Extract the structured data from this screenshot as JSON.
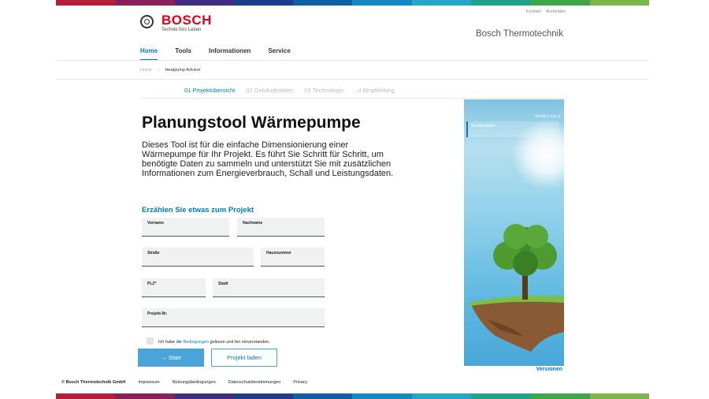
{
  "colors": {
    "accent": "#007bc0",
    "brand_red": "#e20015"
  },
  "top_bar_colors": [
    "#b81c39",
    "#8b1f5a",
    "#3f2d80",
    "#1d3d8c",
    "#0d5fa8",
    "#1388c5",
    "#24a6c8",
    "#1fa38a",
    "#3aa847",
    "#7ab648"
  ],
  "top_links": {
    "contact": "Kontakt",
    "login": "Anmelden"
  },
  "header": {
    "logo_name": "BOSCH",
    "logo_tagline": "Technik fürs Leben",
    "division": "Bosch Thermotechnik"
  },
  "nav": [
    {
      "label": "Home"
    },
    {
      "label": "Tools"
    },
    {
      "label": "Informationen"
    },
    {
      "label": "Service"
    }
  ],
  "breadcrumb": {
    "home": "Home",
    "current": "Heatpump Advisor"
  },
  "steps": [
    {
      "label": "01 Projektübersicht"
    },
    {
      "label": "02 Gebäudedaten"
    },
    {
      "label": "03 Technologie"
    },
    {
      "label": "..ıl Empfehlung"
    }
  ],
  "main": {
    "title": "Planungstool Wärmepumpe",
    "intro": "Dieses Tool ist für die einfache Dimensionierung einer Wärmepumpe für Ihr Projekt. Es führt Sie Schritt für Schritt, um benötigte Daten zu sammeln und unterstützt Sie mit zusätzlichen Informationen zum Energieverbrauch, Schall und Leistungsdaten.",
    "section_title": "Erzählen Sie etwas zum Projekt"
  },
  "form": {
    "vorname": {
      "label": "Vorname",
      "value": ""
    },
    "nachname": {
      "label": "Nachname",
      "value": ""
    },
    "strasse": {
      "label": "Straße",
      "value": ""
    },
    "hausnummer": {
      "label": "Hausnummer",
      "value": ""
    },
    "plz": {
      "label": "PLZ*",
      "value": ""
    },
    "stadt": {
      "label": "Stadt",
      "value": ""
    },
    "projekt_nr": {
      "label": "Projekt-Nr.",
      "value": ""
    }
  },
  "consent": {
    "before": "Ich habe die ",
    "link": "Bedingungen",
    "after": " gelesen und bin einverstanden."
  },
  "buttons": {
    "start": "→ Start",
    "load": "Projekt laden"
  },
  "side_panel": {
    "step_count": "Schritt 1 von 3",
    "tab_label": "Kundendaten"
  },
  "versions_link": "Versionen",
  "footer": {
    "copyright": "© Bosch Thermotechnik GmbH",
    "links": [
      {
        "label": "Impressum"
      },
      {
        "label": "Nutzungsbedingungen"
      },
      {
        "label": "Datenschutzbestimmungen"
      },
      {
        "label": "Privacy"
      }
    ]
  }
}
